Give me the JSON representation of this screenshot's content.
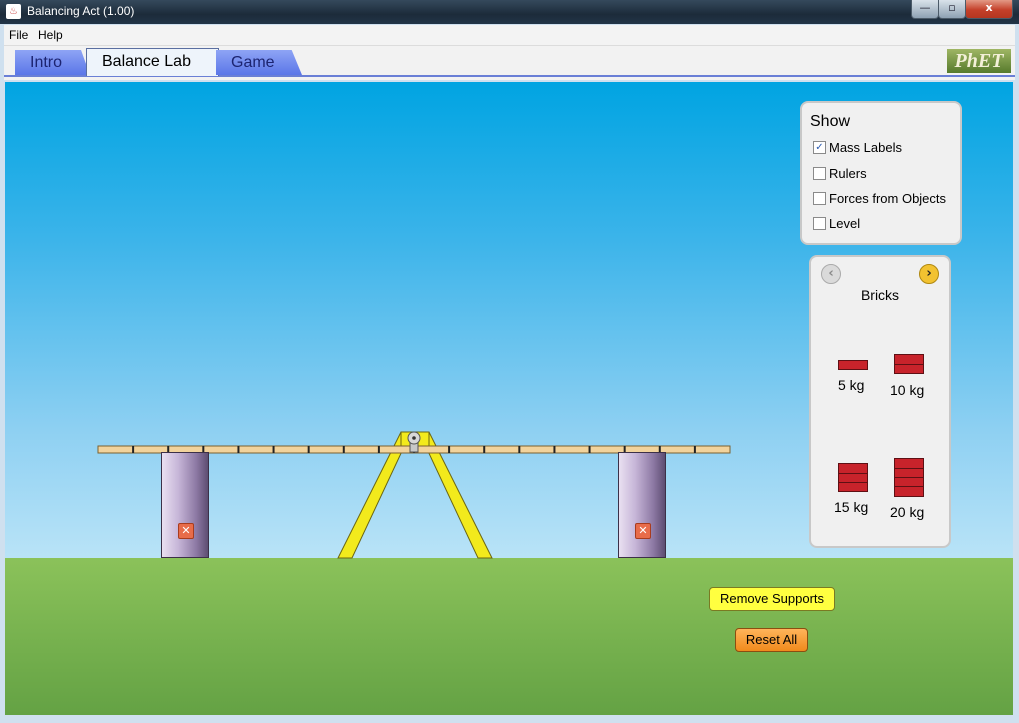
{
  "window": {
    "title": "Balancing Act (1.00)",
    "minimize_glyph": "—",
    "maximize_glyph": "▫",
    "close_glyph": "x"
  },
  "menu": {
    "file": "File",
    "help": "Help"
  },
  "tabs": [
    {
      "label": "Intro",
      "active": false
    },
    {
      "label": "Balance Lab",
      "active": true
    },
    {
      "label": "Game",
      "active": false
    }
  ],
  "logo_text": "PhET",
  "show_panel": {
    "title": "Show",
    "options": [
      {
        "label": "Mass Labels",
        "checked": true
      },
      {
        "label": "Rulers",
        "checked": false
      },
      {
        "label": "Forces from Objects",
        "checked": false
      },
      {
        "label": "Level",
        "checked": false
      }
    ]
  },
  "bricks_panel": {
    "title": "Bricks",
    "prev_glyph": "‹",
    "next_glyph": "›",
    "items": [
      {
        "label": "5 kg",
        "bricks": 1
      },
      {
        "label": "10 kg",
        "bricks": 2
      },
      {
        "label": "15 kg",
        "bricks": 3
      },
      {
        "label": "20 kg",
        "bricks": 4
      }
    ]
  },
  "support_remove_glyph": "✕",
  "buttons": {
    "remove_supports": "Remove Supports",
    "reset_all": "Reset All"
  },
  "colors": {
    "sky_top": "#00a4e2",
    "ground": "#8bc25a",
    "plank": "#f2d39c",
    "fulcrum": "#f2ea1c",
    "brick": "#c8232b"
  }
}
